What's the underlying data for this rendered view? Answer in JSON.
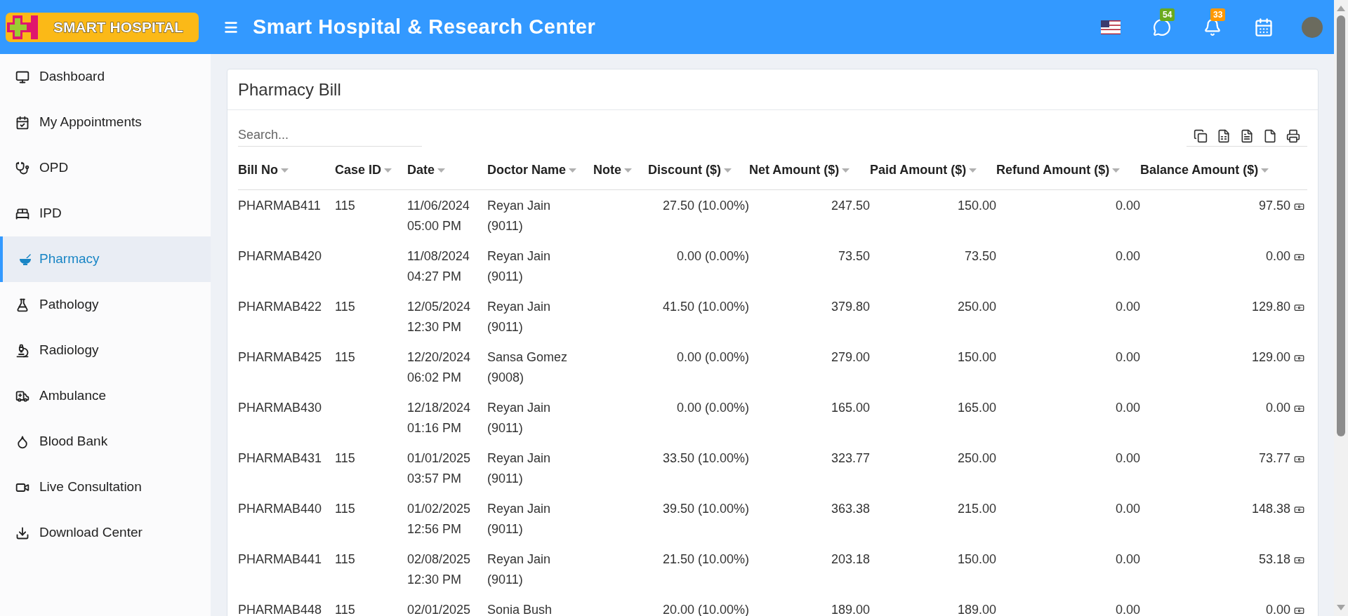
{
  "header": {
    "logo_text": "SMART HOSPITAL",
    "title": "Smart Hospital & Research Center",
    "whatsapp_count": "54",
    "notification_count": "33"
  },
  "sidebar": {
    "items": [
      {
        "label": "Dashboard",
        "selected": false
      },
      {
        "label": "My Appointments",
        "selected": false
      },
      {
        "label": "OPD",
        "selected": false
      },
      {
        "label": "IPD",
        "selected": false
      },
      {
        "label": "Pharmacy",
        "selected": true
      },
      {
        "label": "Pathology",
        "selected": false
      },
      {
        "label": "Radiology",
        "selected": false
      },
      {
        "label": "Ambulance",
        "selected": false
      },
      {
        "label": "Blood Bank",
        "selected": false
      },
      {
        "label": "Live Consultation",
        "selected": false
      },
      {
        "label": "Download Center",
        "selected": false
      }
    ]
  },
  "card": {
    "title": "Pharmacy Bill",
    "search": {
      "placeholder": "Search..."
    },
    "table": {
      "columns": [
        "Bill No",
        "Case ID",
        "Date",
        "Doctor Name",
        "Note",
        "Discount ($)",
        "Net Amount ($)",
        "Paid Amount ($)",
        "Refund Amount ($)",
        "Balance Amount ($)"
      ],
      "rows": [
        {
          "bill_no": "PHARMAB411",
          "case_id": "115",
          "date": [
            "11/06/2024",
            "05:00 PM"
          ],
          "doctor": [
            "Reyan Jain",
            "(9011)"
          ],
          "discount": "27.50 (10.00%)",
          "net": "247.50",
          "paid": "150.00",
          "refund": "0.00",
          "balance": "97.50"
        },
        {
          "bill_no": "PHARMAB420",
          "case_id": "",
          "date": [
            "11/08/2024",
            "04:27 PM"
          ],
          "doctor": [
            "Reyan Jain",
            "(9011)"
          ],
          "discount": "0.00 (0.00%)",
          "net": "73.50",
          "paid": "73.50",
          "refund": "0.00",
          "balance": "0.00"
        },
        {
          "bill_no": "PHARMAB422",
          "case_id": "115",
          "date": [
            "12/05/2024",
            "12:30 PM"
          ],
          "doctor": [
            "Reyan Jain",
            "(9011)"
          ],
          "discount": "41.50 (10.00%)",
          "net": "379.80",
          "paid": "250.00",
          "refund": "0.00",
          "balance": "129.80"
        },
        {
          "bill_no": "PHARMAB425",
          "case_id": "115",
          "date": [
            "12/20/2024",
            "06:02 PM"
          ],
          "doctor": [
            "Sansa Gomez",
            "(9008)"
          ],
          "discount": "0.00 (0.00%)",
          "net": "279.00",
          "paid": "150.00",
          "refund": "0.00",
          "balance": "129.00"
        },
        {
          "bill_no": "PHARMAB430",
          "case_id": "",
          "date": [
            "12/18/2024",
            "01:16 PM"
          ],
          "doctor": [
            "Reyan Jain",
            "(9011)"
          ],
          "discount": "0.00 (0.00%)",
          "net": "165.00",
          "paid": "165.00",
          "refund": "0.00",
          "balance": "0.00"
        },
        {
          "bill_no": "PHARMAB431",
          "case_id": "115",
          "date": [
            "01/01/2025",
            "03:57 PM"
          ],
          "doctor": [
            "Reyan Jain",
            "(9011)"
          ],
          "discount": "33.50 (10.00%)",
          "net": "323.77",
          "paid": "250.00",
          "refund": "0.00",
          "balance": "73.77"
        },
        {
          "bill_no": "PHARMAB440",
          "case_id": "115",
          "date": [
            "01/02/2025",
            "12:56 PM"
          ],
          "doctor": [
            "Reyan Jain",
            "(9011)"
          ],
          "discount": "39.50 (10.00%)",
          "net": "363.38",
          "paid": "215.00",
          "refund": "0.00",
          "balance": "148.38"
        },
        {
          "bill_no": "PHARMAB441",
          "case_id": "115",
          "date": [
            "02/08/2025",
            "12:30 PM"
          ],
          "doctor": [
            "Reyan Jain",
            "(9011)"
          ],
          "discount": "21.50 (10.00%)",
          "net": "203.18",
          "paid": "150.00",
          "refund": "0.00",
          "balance": "53.18"
        },
        {
          "bill_no": "PHARMAB448",
          "case_id": "115",
          "date": [
            "02/01/2025"
          ],
          "doctor": [
            "Sonia Bush"
          ],
          "discount": "20.00 (10.00%)",
          "net": "189.00",
          "paid": "189.00",
          "refund": "0.00",
          "balance": "0.00"
        }
      ]
    }
  }
}
